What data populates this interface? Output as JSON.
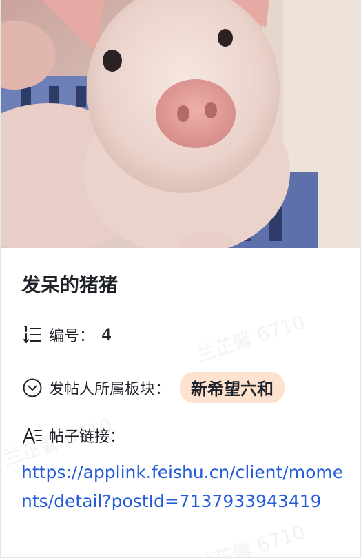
{
  "card": {
    "title": "发呆的猪猪",
    "fields": {
      "number": {
        "label": "编号：",
        "value": "4",
        "icon": "list-number-icon"
      },
      "board": {
        "label": "发帖人所属板块：",
        "value": "新希望六和",
        "icon": "dropdown-circle-icon",
        "tag_color": "#fde3cf"
      },
      "link": {
        "label": "帖子链接：",
        "value": "https://applink.feishu.cn/client/moments/detail?postId=7137933943419",
        "icon": "text-field-icon"
      }
    },
    "cover_image": {
      "description": "piglet",
      "icon": "cover-image"
    }
  },
  "watermark": {
    "text": "兰芷馨 6710"
  },
  "colors": {
    "link": "#245bdb",
    "tag_bg": "#fde3cf",
    "text": "#1f2329"
  }
}
